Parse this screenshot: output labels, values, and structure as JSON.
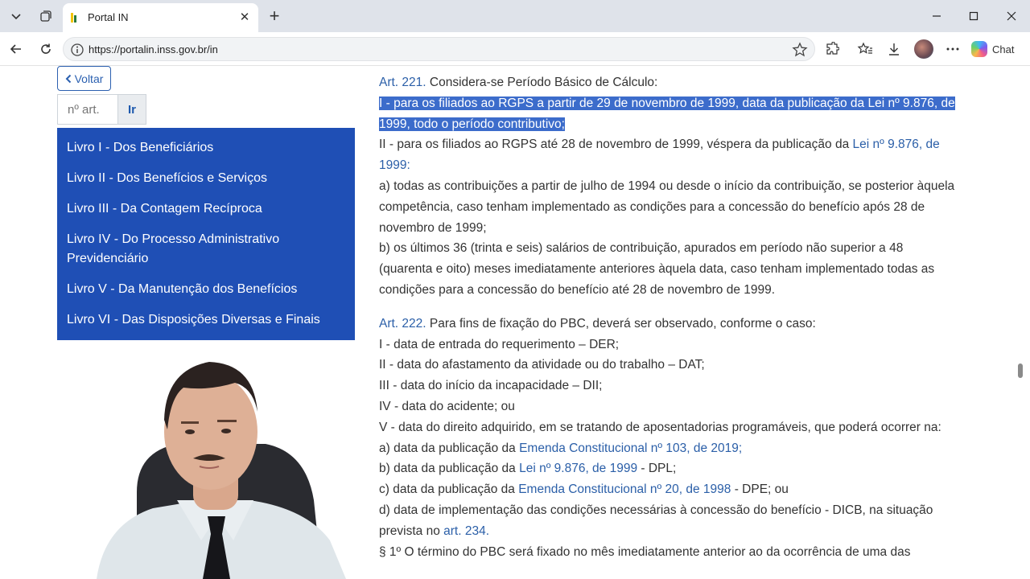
{
  "browser": {
    "tab_title": "Portal IN",
    "url": "https://portalin.inss.gov.br/in",
    "chat_label": "Chat",
    "new_tab_symbol": "+",
    "close_symbol": "✕"
  },
  "sidebar": {
    "back_label": "Voltar",
    "article_placeholder": "nº art.",
    "go_label": "Ir",
    "books": [
      "Livro I - Dos Beneficiários",
      "Livro II - Dos Benefícios e Serviços",
      "Livro III - Da Contagem Recíproca",
      "Livro IV - Do Processo Administrativo Previdenciário",
      "Livro V - Da Manutenção dos Benefícios",
      "Livro VI - Das Disposições Diversas e Finais"
    ]
  },
  "article221": {
    "ref": "Art. 221.",
    "text": " Considera-se Período Básico de Cálculo:",
    "item1": "I - para os filiados ao RGPS a partir de 29 de novembro de 1999, data da publicação da Lei nº 9.876, de 1999, todo o período contributivo;",
    "item2_pre": "II - para os filiados ao RGPS até 28 de novembro de 1999, véspera da publicação da ",
    "item2_link": "Lei nº 9.876, de 1999",
    "item2_post": ":",
    "item_a": "a) todas as contribuições a partir de julho de 1994 ou desde o início da contribuição, se posterior àquela competência, caso tenham implementado as condições para a concessão do benefício após 28 de novembro de 1999;",
    "item_b": "b) os últimos 36 (trinta e seis) salários de contribuição, apurados em período não superior a 48 (quarenta e oito) meses imediatamente anteriores àquela data, caso tenham implementado todas as condições para a concessão do benefício até 28 de novembro de 1999."
  },
  "article222": {
    "ref": "Art. 222.",
    "text": " Para fins de fixação do PBC, deverá ser observado, conforme o caso:",
    "i1": "I - data de entrada do requerimento – DER;",
    "i2": "II - data do afastamento da atividade ou do trabalho – DAT;",
    "i3": "III - data do início da incapacidade – DII;",
    "i4": "IV - data do acidente; ou",
    "i5": "V - data do direito adquirido, em se tratando de aposentadorias programáveis, que poderá ocorrer na:",
    "a_pre": "a) data da publicação da ",
    "a_link": "Emenda Constitucional nº 103, de 2019",
    "a_post": ";",
    "b_pre": "b) data da publicação da ",
    "b_link": "Lei nº 9.876, de 1999",
    "b_post": " - DPL;",
    "c_pre": "c) data da publicação da ",
    "c_link": "Emenda Constitucional nº 20, de 1998",
    "c_post": " - DPE; ou",
    "d_pre": "d) data de implementação das condições necessárias à concessão do benefício - DICB, na situação prevista no ",
    "d_link": "art. 234",
    "d_post": ".",
    "p1": "§ 1º O término do PBC será fixado no mês imediatamente anterior ao da ocorrência de uma das"
  }
}
